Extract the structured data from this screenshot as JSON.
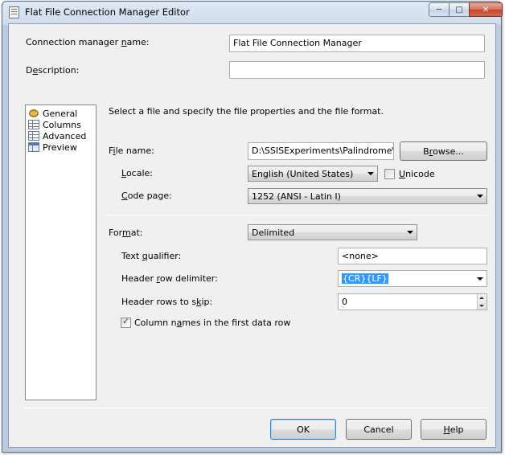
{
  "window": {
    "title": "Flat File Connection Manager Editor",
    "controls": {
      "minimize": "─",
      "maximize": "□",
      "close": "✕"
    }
  },
  "connection": {
    "name_label_pre": "Connection manager ",
    "name_label_u": "n",
    "name_label_post": "ame:",
    "name_value": "Flat File Connection Manager",
    "description_label_pre": "D",
    "description_label_u": "e",
    "description_label_post": "scription:",
    "description_value": ""
  },
  "nav": {
    "items": [
      {
        "label": "General",
        "icon": "general-icon",
        "selected": true
      },
      {
        "label": "Columns",
        "icon": "columns-icon"
      },
      {
        "label": "Advanced",
        "icon": "advanced-icon"
      },
      {
        "label": "Preview",
        "icon": "preview-icon"
      }
    ]
  },
  "general": {
    "instructions": "Select a file and specify the file properties and the file format.",
    "file_name_label_pre": "F",
    "file_name_label_u": "i",
    "file_name_label_post": "le name:",
    "file_name_value": "D:\\SSISExperiments\\Palindrome\\Sourc",
    "browse_label_pre": "B",
    "browse_label_u": "r",
    "browse_label_post": "owse...",
    "locale_label_pre": "",
    "locale_label_u": "L",
    "locale_label_post": "ocale:",
    "locale_value": "English (United States)",
    "unicode_label_pre": "",
    "unicode_label_u": "U",
    "unicode_label_post": "nicode",
    "unicode_checked": false,
    "code_page_label_pre": "",
    "code_page_label_u": "C",
    "code_page_label_post": "ode page:",
    "code_page_value": "1252  (ANSI - Latin I)"
  },
  "format": {
    "format_label_pre": "For",
    "format_label_u": "m",
    "format_label_post": "at:",
    "format_value": "Delimited",
    "text_qualifier_label_pre": "Text ",
    "text_qualifier_label_u": "q",
    "text_qualifier_label_post": "ualifier:",
    "text_qualifier_value": "<none>",
    "header_row_delim_label_pre": "Header ",
    "header_row_delim_label_u": "r",
    "header_row_delim_label_post": "ow delimiter:",
    "header_row_delim_value": "{CR}{LF}",
    "header_rows_skip_label_pre": "Header rows to s",
    "header_rows_skip_label_u": "k",
    "header_rows_skip_label_post": "ip:",
    "header_rows_skip_value": "0",
    "column_names_label_pre": "Column n",
    "column_names_label_u": "a",
    "column_names_label_post": "mes in the first data row",
    "column_names_checked": true
  },
  "footer": {
    "ok_label": "OK",
    "cancel_label": "Cancel",
    "help_label_pre": "",
    "help_label_u": "H",
    "help_label_post": "elp"
  }
}
